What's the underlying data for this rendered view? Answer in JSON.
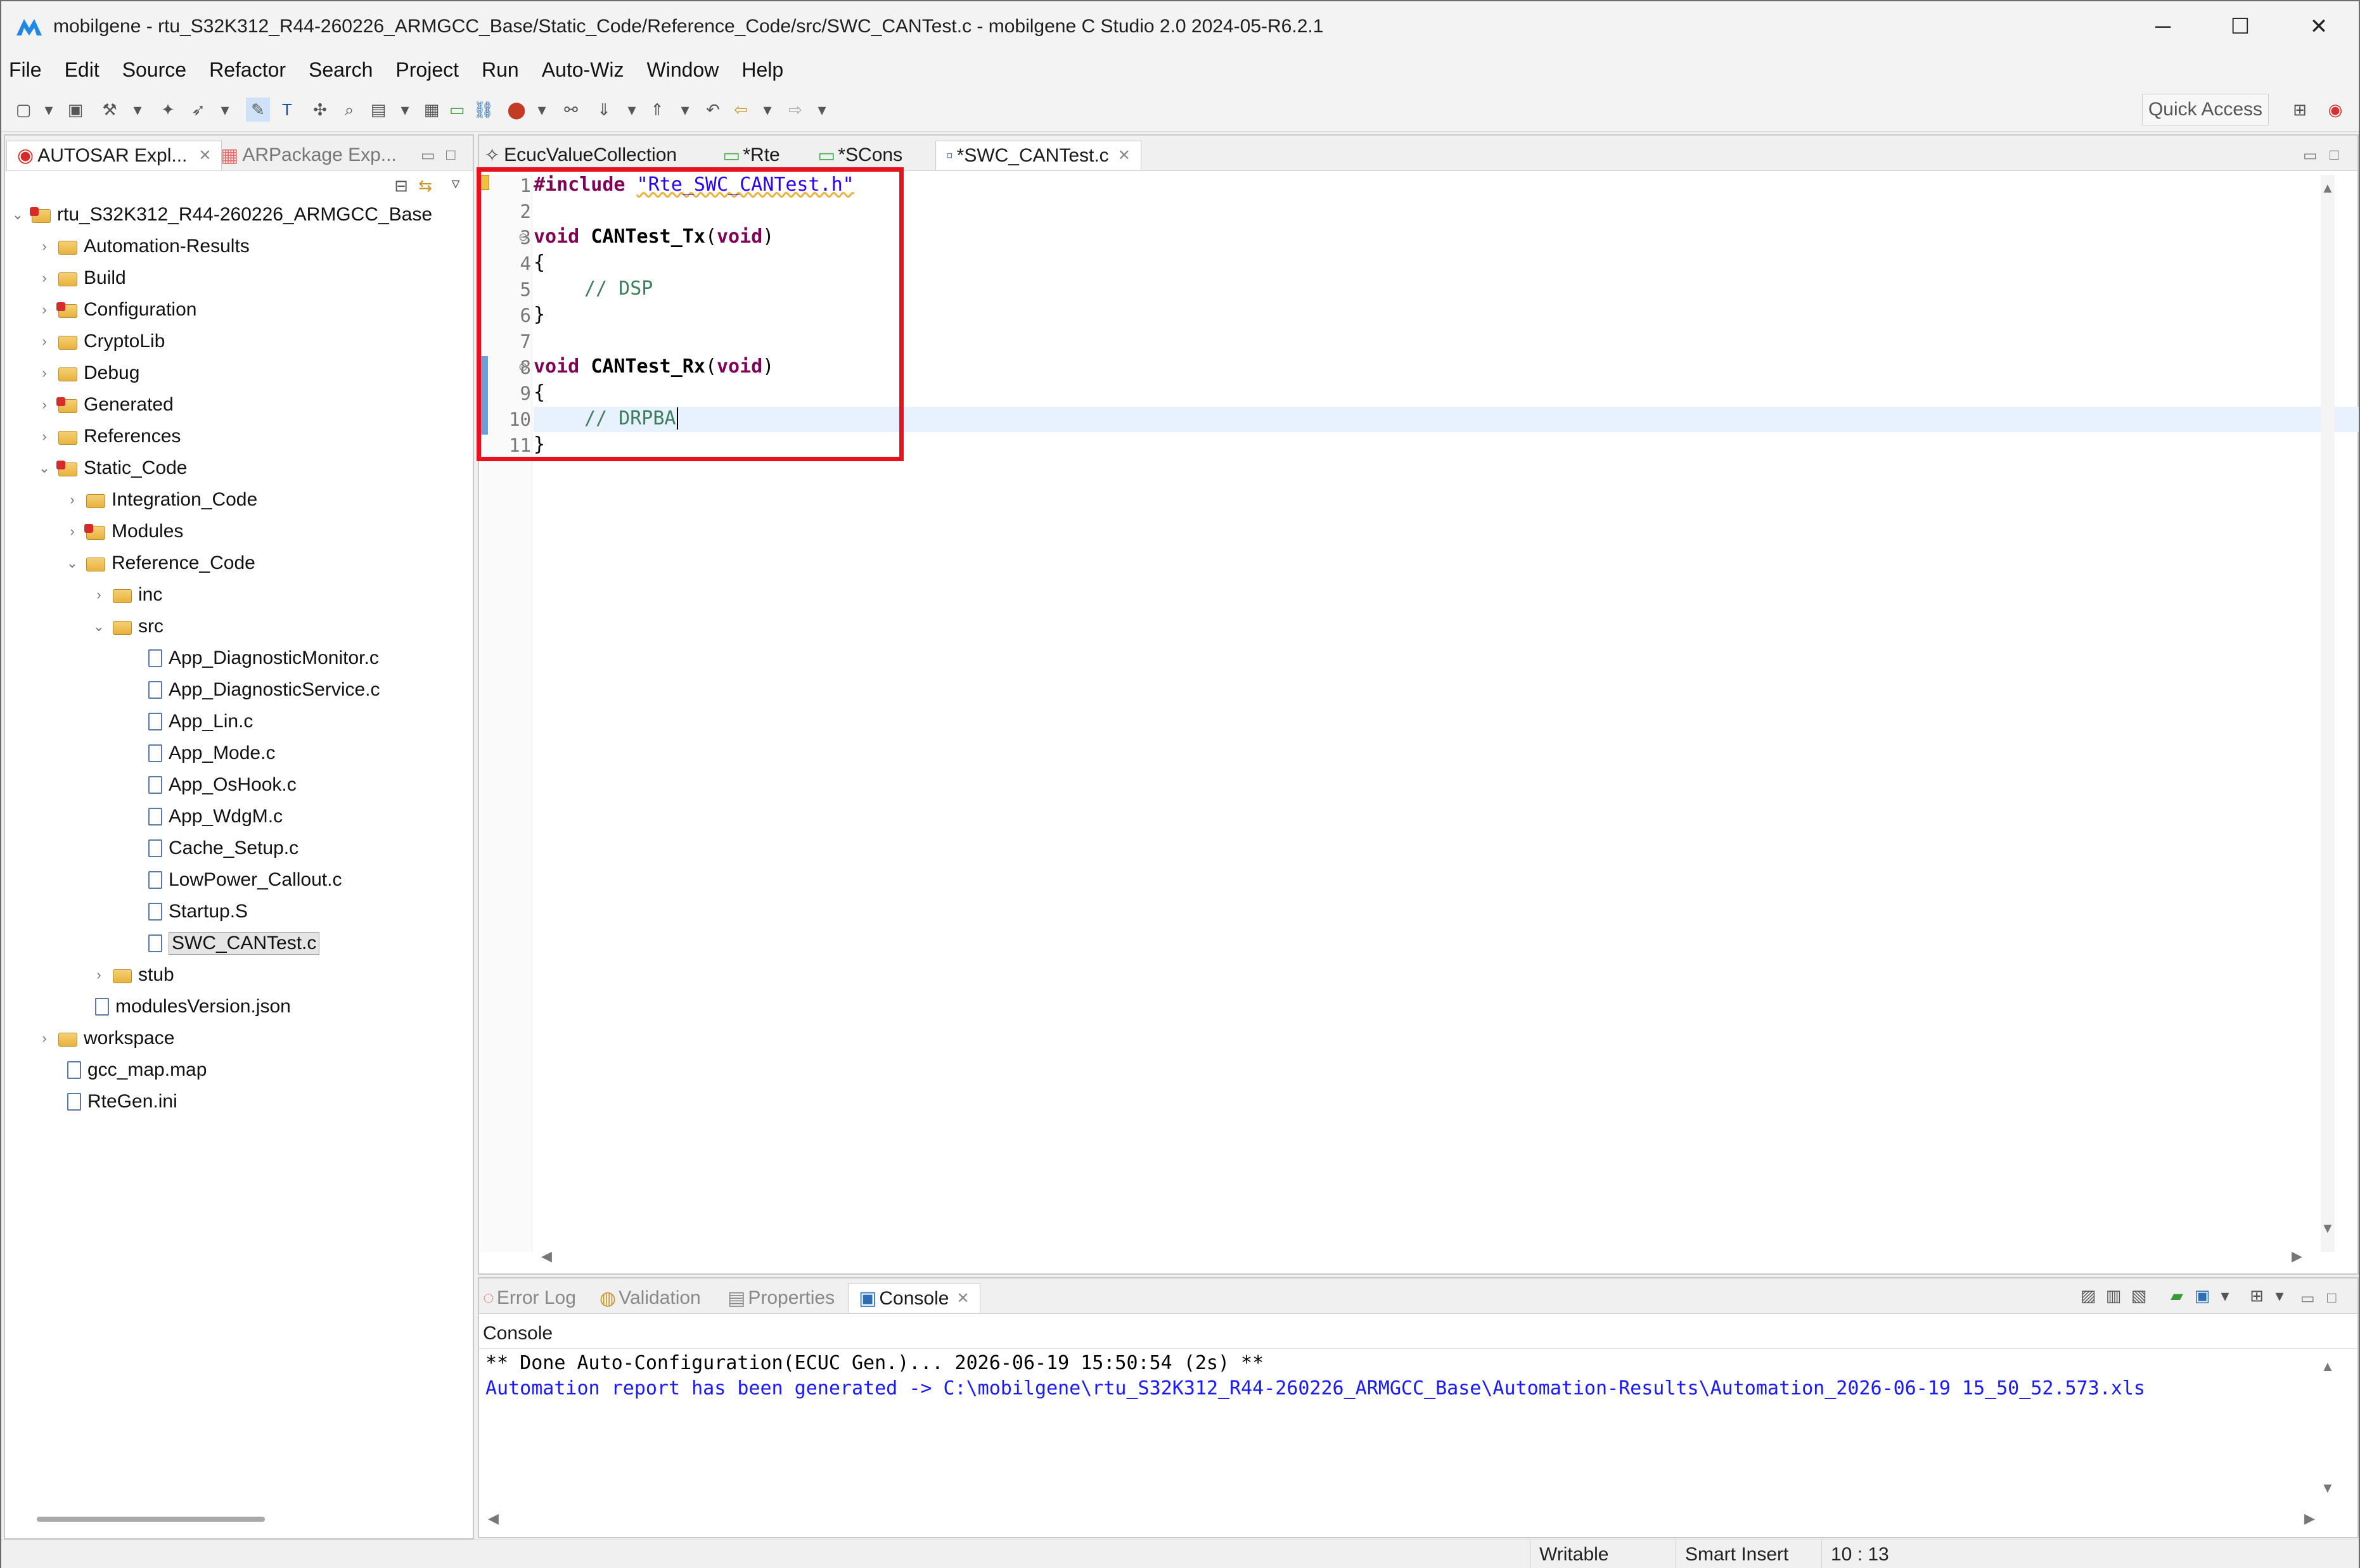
{
  "window": {
    "title": "mobilgene - rtu_S32K312_R44-260226_ARMGCC_Base/Static_Code/Reference_Code/src/SWC_CANTest.c - mobilgene C Studio 2.0 2024-05-R6.2.1",
    "minimize": "─",
    "maximize": "☐",
    "close": "✕"
  },
  "menu": [
    "File",
    "Edit",
    "Source",
    "Refactor",
    "Search",
    "Project",
    "Run",
    "Auto-Wiz",
    "Window",
    "Help"
  ],
  "toolbar": {
    "quick_access": "Quick Access"
  },
  "explorer": {
    "tabs": [
      "AUTOSAR Expl...",
      "ARPackage Exp..."
    ],
    "project": "rtu_S32K312_R44-260226_ARMGCC_Base",
    "items": [
      "Automation-Results",
      "Build",
      "Configuration",
      "CryptoLib",
      "Debug",
      "Generated",
      "References",
      "Static_Code",
      "Integration_Code",
      "Modules",
      "Reference_Code",
      "inc",
      "src",
      "App_DiagnosticMonitor.c",
      "App_DiagnosticService.c",
      "App_Lin.c",
      "App_Mode.c",
      "App_OsHook.c",
      "App_WdgM.c",
      "Cache_Setup.c",
      "LowPower_Callout.c",
      "Startup.S",
      "SWC_CANTest.c",
      "stub",
      "modulesVersion.json",
      "workspace",
      "gcc_map.map",
      "RteGen.ini"
    ]
  },
  "editor": {
    "tabs": [
      "EcucValueCollection",
      "*Rte",
      "*SCons",
      "*SWC_CANTest.c"
    ],
    "lines": [
      "1",
      "2",
      "3",
      "4",
      "5",
      "6",
      "7",
      "8",
      "9",
      "10",
      "11"
    ],
    "code": {
      "include_kw": "#include",
      "include_file": "\"Rte_SWC_CANTest.h\"",
      "void": "void",
      "fn_tx": "CANTest_Tx",
      "fn_rx": "CANTest_Rx",
      "param": "(void)",
      "paren_open": "(",
      "paren_close": ")",
      "open_brace": "{",
      "close_brace": "}",
      "comment_tx": "// DSP",
      "comment_rx": "// DRPBA"
    }
  },
  "console": {
    "tabs": [
      "Error Log",
      "Validation",
      "Properties",
      "Console"
    ],
    "title": "Console",
    "line1": "** Done Auto-Configuration(ECUC Gen.)... 2026-06-19 15:50:54 (2s) **",
    "line2": "Automation report has been generated -> C:\\mobilgene\\rtu_S32K312_R44-260226_ARMGCC_Base\\Automation-Results\\Automation_2026-06-19 15_50_52.573.xls"
  },
  "status": {
    "mode": "Writable",
    "insert": "Smart Insert",
    "position": "10 : 13"
  }
}
